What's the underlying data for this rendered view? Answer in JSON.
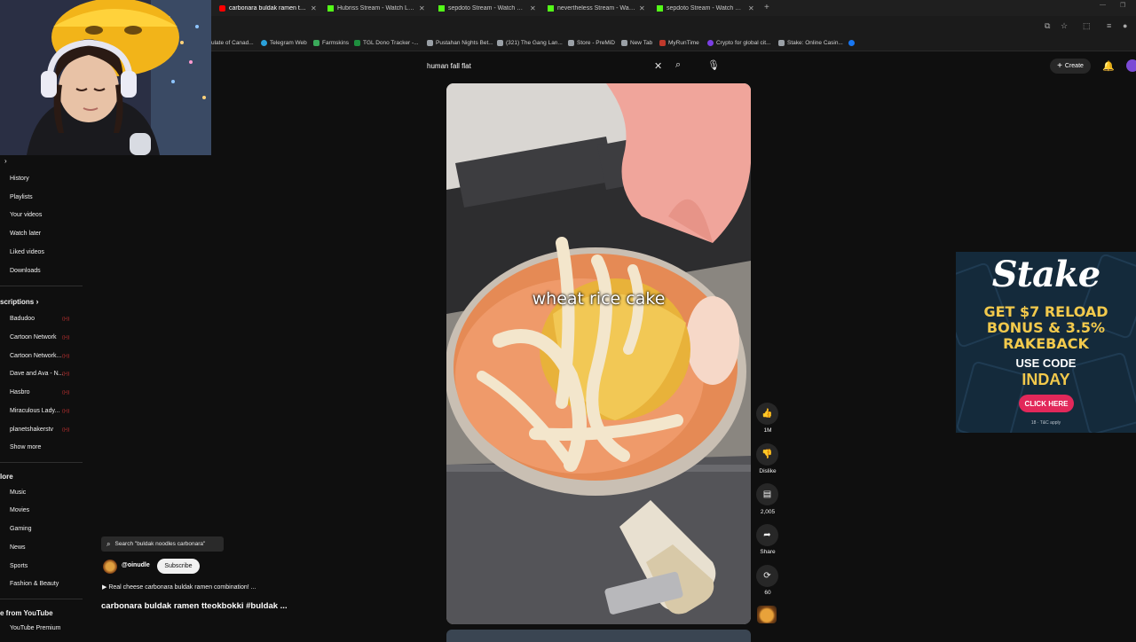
{
  "browser": {
    "tabs": [
      {
        "title": "carbonara buldak ramen tteokbokki",
        "icon": "youtube-icon",
        "active": true
      },
      {
        "title": "Hubriss Stream - Watch Live o",
        "icon": "kick-icon"
      },
      {
        "title": "sepdoto Stream - Watch Live o",
        "icon": "kick-icon"
      },
      {
        "title": "nevertheless Stream - Watch Li",
        "icon": "kick-icon"
      },
      {
        "title": "sepdoto Stream - Watch Live o",
        "icon": "kick-icon"
      }
    ],
    "bookmarks": [
      {
        "label": "ulate of Canad...",
        "color": "#9aa0a6"
      },
      {
        "label": "Telegram Web",
        "color": "#2aa1da"
      },
      {
        "label": "Farmskins",
        "color": "#3aa95a"
      },
      {
        "label": "TGL Dono Tracker -...",
        "color": "#1e8e3e"
      },
      {
        "label": "Pustahan Nights Bet...",
        "color": "#9aa0a6"
      },
      {
        "label": "(321) The Gang Lan...",
        "color": "#9aa0a6"
      },
      {
        "label": "Store - PreMiD",
        "color": "#9aa0a6"
      },
      {
        "label": "New Tab",
        "color": "#9aa0a6"
      },
      {
        "label": "MyRunTime",
        "color": "#c0392b"
      },
      {
        "label": "Crypto for global cit...",
        "color": "#7b3fe4"
      },
      {
        "label": "Stake: Online Casin...",
        "color": "#9aa0a6"
      }
    ]
  },
  "header": {
    "search_value": "human fall flat",
    "create_label": "Create"
  },
  "sidebar": {
    "you_items": [
      "History",
      "Playlists",
      "Your videos",
      "Watch later",
      "Liked videos",
      "Downloads"
    ],
    "subscriptions_header": "scriptions",
    "subscriptions": [
      "Badudoo",
      "Cartoon Network",
      "Cartoon Network...",
      "Dave and Ava - N...",
      "Hasbro",
      "Miraculous Lady...",
      "planetshakerstv"
    ],
    "show_more": "Show more",
    "explore_header": "lore",
    "explore": [
      "Music",
      "Movies",
      "Gaming",
      "News",
      "Sports",
      "Fashion & Beauty"
    ],
    "more_header": "e from YouTube",
    "more_items": [
      "YouTube Premium"
    ]
  },
  "short": {
    "caption": "wheat rice cake",
    "search_chip": "Search \"buldak noodles carbonara\"",
    "channel": "@oinudle",
    "subscribe_label": "Subscribe",
    "sound_line": "Real cheese carbonara buldak ramen combination! ...",
    "title": "carbonara buldak ramen tteokbokki #buldak ..."
  },
  "actions": {
    "likes": "1M",
    "dislike_label": "Dislike",
    "comments": "2,005",
    "share_label": "Share",
    "remix": "60"
  },
  "ad": {
    "brand": "Stake",
    "headline_lines": [
      "GET $7 RELOAD",
      "BONUS & 3.5%",
      "RAKEBACK"
    ],
    "use_code_label": "USE CODE",
    "code": "INDAY",
    "cta": "CLICK HERE",
    "fine_print": "18 · T&C apply",
    "colors": {
      "background": "#142a3b",
      "accent": "#f2c94c",
      "cta": "#e2285a"
    }
  }
}
